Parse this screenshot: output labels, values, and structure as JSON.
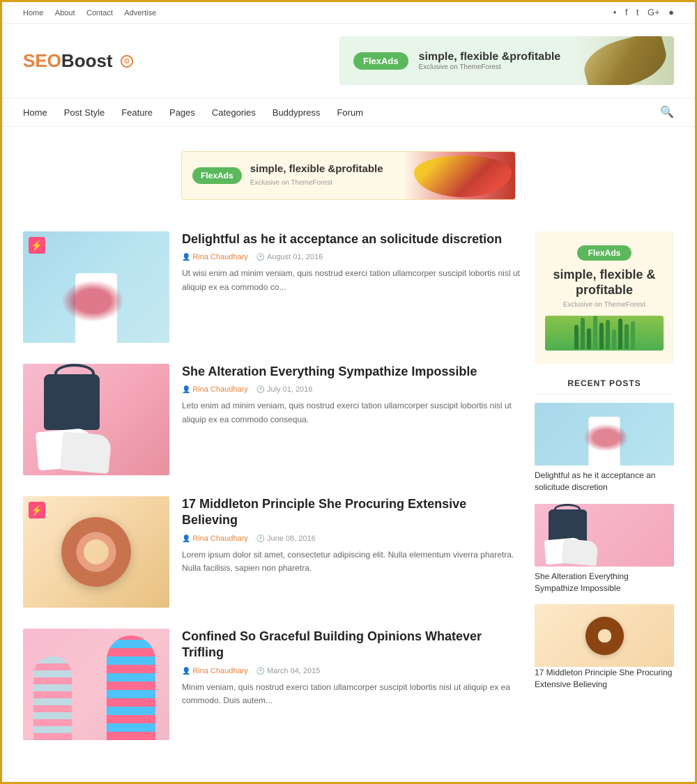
{
  "border_color": "#d4a017",
  "topbar": {
    "nav_links": [
      "Home",
      "About",
      "Contact",
      "Advertise"
    ],
    "social_icons": [
      "rss",
      "facebook",
      "twitter",
      "google-plus",
      "instagram"
    ]
  },
  "logo": {
    "seo": "SEO",
    "boost": "Boost",
    "icon": "⊙"
  },
  "header_ad": {
    "button_label": "FlexAds",
    "headline": "simple, flexible &profitable",
    "subtext": "Exclusive on ThemeForest"
  },
  "main_nav": {
    "links": [
      "Home",
      "Post Style",
      "Feature",
      "Pages",
      "Categories",
      "Buddypress",
      "Forum"
    ]
  },
  "banner_ad": {
    "button_label": "FlexAds",
    "headline": "simple, flexible &profitable",
    "subtext": "Exclusive on ThemeForest"
  },
  "posts": [
    {
      "id": 1,
      "has_badge": true,
      "title": "Delightful as he it acceptance an solicitude discretion",
      "author": "Rina Chaudhary",
      "date": "August 01, 2016",
      "excerpt": "Ut wisi enim ad minim veniam, quis nostrud exerci tation ullamcorper suscipit lobortis nisl ut aliquip ex ea commodo co...",
      "thumb_style": "thumb-1"
    },
    {
      "id": 2,
      "has_badge": false,
      "title": "She Alteration Everything Sympathize Impossible",
      "author": "Rina Chaudhary",
      "date": "July 01, 2016",
      "excerpt": "Leto enim ad minim veniam, quis nostrud exerci tation ullamcorper suscipit lobortis nisl ut aliquip ex ea commodo consequa.",
      "thumb_style": "thumb-2"
    },
    {
      "id": 3,
      "has_badge": true,
      "title": "17 Middleton Principle She Procuring Extensive Believing",
      "author": "Rina Chaudhary",
      "date": "June 08, 2016",
      "excerpt": "Lorem ipsum dolor sit amet, consectetur adipiscing elit. Nulla elementum viverra pharetra. Nulla facilisis, sapien non pharetra.",
      "thumb_style": "thumb-3"
    },
    {
      "id": 4,
      "has_badge": false,
      "title": "Confined So Graceful Building Opinions Whatever Trifling",
      "author": "Rina Chaudhary",
      "date": "March 04, 2015",
      "excerpt": "Minim veniam, quis nostrud exerci tation ullamcorper suscipit lobortis nisl ut aliquip ex ea commodo. Duis autem...",
      "thumb_style": "thumb-4"
    }
  ],
  "sidebar": {
    "ad": {
      "button_label": "FlexAds",
      "headline": "simple, flexible &\nprofitable",
      "subtext": "Exclusive on ThemeForest"
    },
    "recent_posts_title": "RECENT POSTS",
    "recent_posts": [
      {
        "title": "Delightful as he it acceptance an solicitude discretion",
        "thumb": "rthumb-1"
      },
      {
        "title": "She Alteration Everything Sympathize Impossible",
        "thumb": "rthumb-2"
      },
      {
        "title": "17 Middleton Principle She Procuring Extensive Believing",
        "thumb": "rthumb-3"
      }
    ]
  }
}
